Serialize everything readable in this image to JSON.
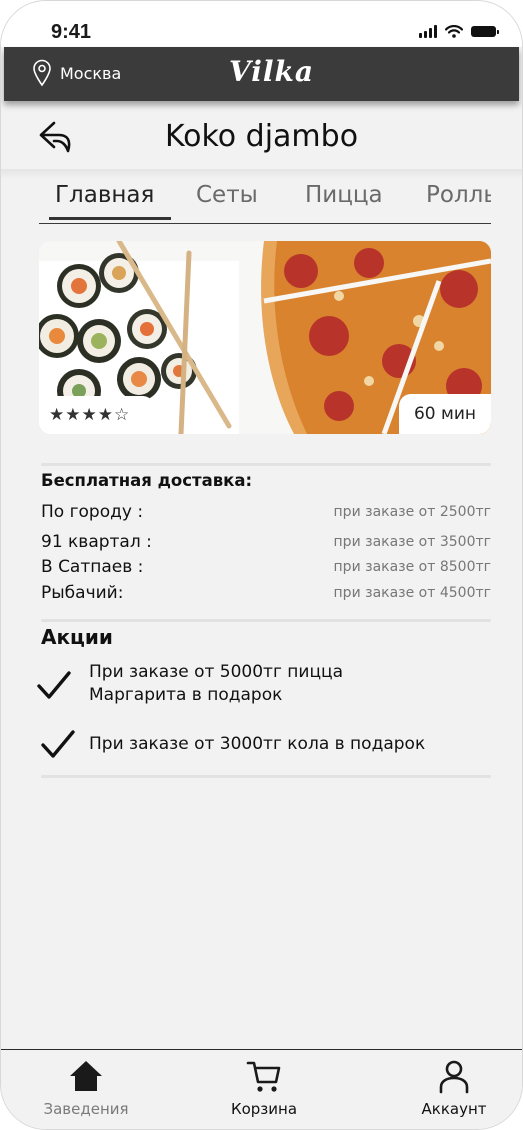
{
  "status_bar": {
    "time": "9:41"
  },
  "header": {
    "location_icon": "map-pin-icon",
    "city": "Москва",
    "logo_text": "Vilka"
  },
  "page": {
    "back_icon": "back-arrow-icon",
    "title": "Koko djambo"
  },
  "tabs": [
    {
      "label": "Главная",
      "active": true
    },
    {
      "label": "Сеты",
      "active": false
    },
    {
      "label": "Пицца",
      "active": false
    },
    {
      "label": "Роллы",
      "active": false
    }
  ],
  "hero": {
    "rating_stars": "★★★★☆",
    "rating_value": 4,
    "rating_max": 5,
    "eta": "60 мин"
  },
  "delivery": {
    "title": "Бесплатная доставка:",
    "zones": [
      {
        "name": "По городу :",
        "condition": "при заказе от 2500тг"
      },
      {
        "name": "91 квартал :",
        "condition": "при заказе от 3500тг"
      },
      {
        "name": "В Сатпаев :",
        "condition": "при заказе от 8500тг"
      },
      {
        "name": "Рыбачий:",
        "condition": "при заказе от 4500тг"
      }
    ]
  },
  "promotions": {
    "title": "Акции",
    "items": [
      {
        "line1": "При заказе от 5000тг пицца",
        "line2": "Маргарита в подарок"
      },
      {
        "line1": "При заказе от 3000тг кола в подарок",
        "line2": ""
      }
    ]
  },
  "bottom_nav": [
    {
      "label": "Заведения",
      "icon": "home-icon"
    },
    {
      "label": "Корзина",
      "icon": "cart-icon"
    },
    {
      "label": "Аккаунт",
      "icon": "user-icon"
    }
  ],
  "colors": {
    "header_bg": "#3b3b3b",
    "page_bg": "#f2f2f2",
    "pizza_sauce": "#d9832f",
    "pepperoni": "#b8342a"
  }
}
